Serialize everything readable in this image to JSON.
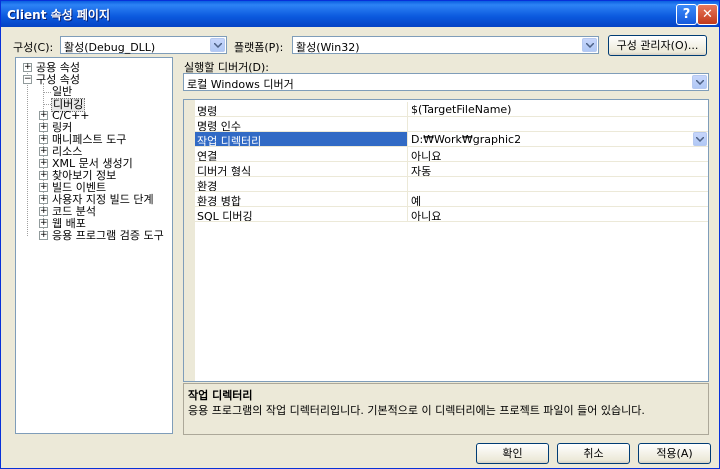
{
  "window": {
    "title": "Client 속성 페이지",
    "help": "?",
    "close": "✕"
  },
  "config_bar": {
    "config_label": "구성(C):",
    "config_value": "활성(Debug_DLL)",
    "platform_label": "플랫폼(P):",
    "platform_value": "활성(Win32)",
    "manager_button": "구성 관리자(O)..."
  },
  "tree": {
    "common": "공용 속성",
    "config": "구성 속성",
    "general": "일반",
    "debugging": "디버깅",
    "cpp": "C/C++",
    "linker": "링커",
    "manifest": "매니페스트 도구",
    "resources": "리소스",
    "xml": "XML 문서 생성기",
    "browse": "찾아보기 정보",
    "build_events": "빌드 이벤트",
    "custom_build": "사용자 지정 빌드 단계",
    "code_analysis": "코드 분석",
    "web_deploy": "웹 배포",
    "app_verifier": "응용 프로그램 검증 도구"
  },
  "debugger": {
    "label": "실행할 디버거(D):",
    "value": "로컬 Windows 디버거"
  },
  "properties": [
    {
      "name": "명령",
      "value": "$(TargetFileName)"
    },
    {
      "name": "명령 인수",
      "value": ""
    },
    {
      "name": "작업 디렉터리",
      "value": "D:₩Work₩graphic2"
    },
    {
      "name": "연결",
      "value": "아니요"
    },
    {
      "name": "디버거 형식",
      "value": "자동"
    },
    {
      "name": "환경",
      "value": ""
    },
    {
      "name": "환경 병합",
      "value": "예"
    },
    {
      "name": "SQL 디버깅",
      "value": "아니요"
    }
  ],
  "description": {
    "title": "작업 디렉터리",
    "text": "응용 프로그램의 작업 디렉터리입니다. 기본적으로 이 디렉터리에는 프로젝트 파일이 들어 있습니다."
  },
  "buttons": {
    "ok": "확인",
    "cancel": "취소",
    "apply": "적용(A)"
  },
  "colors": {
    "titlebar": "#0b59de",
    "selection": "#316ac5",
    "dialog": "#ece9d8"
  }
}
